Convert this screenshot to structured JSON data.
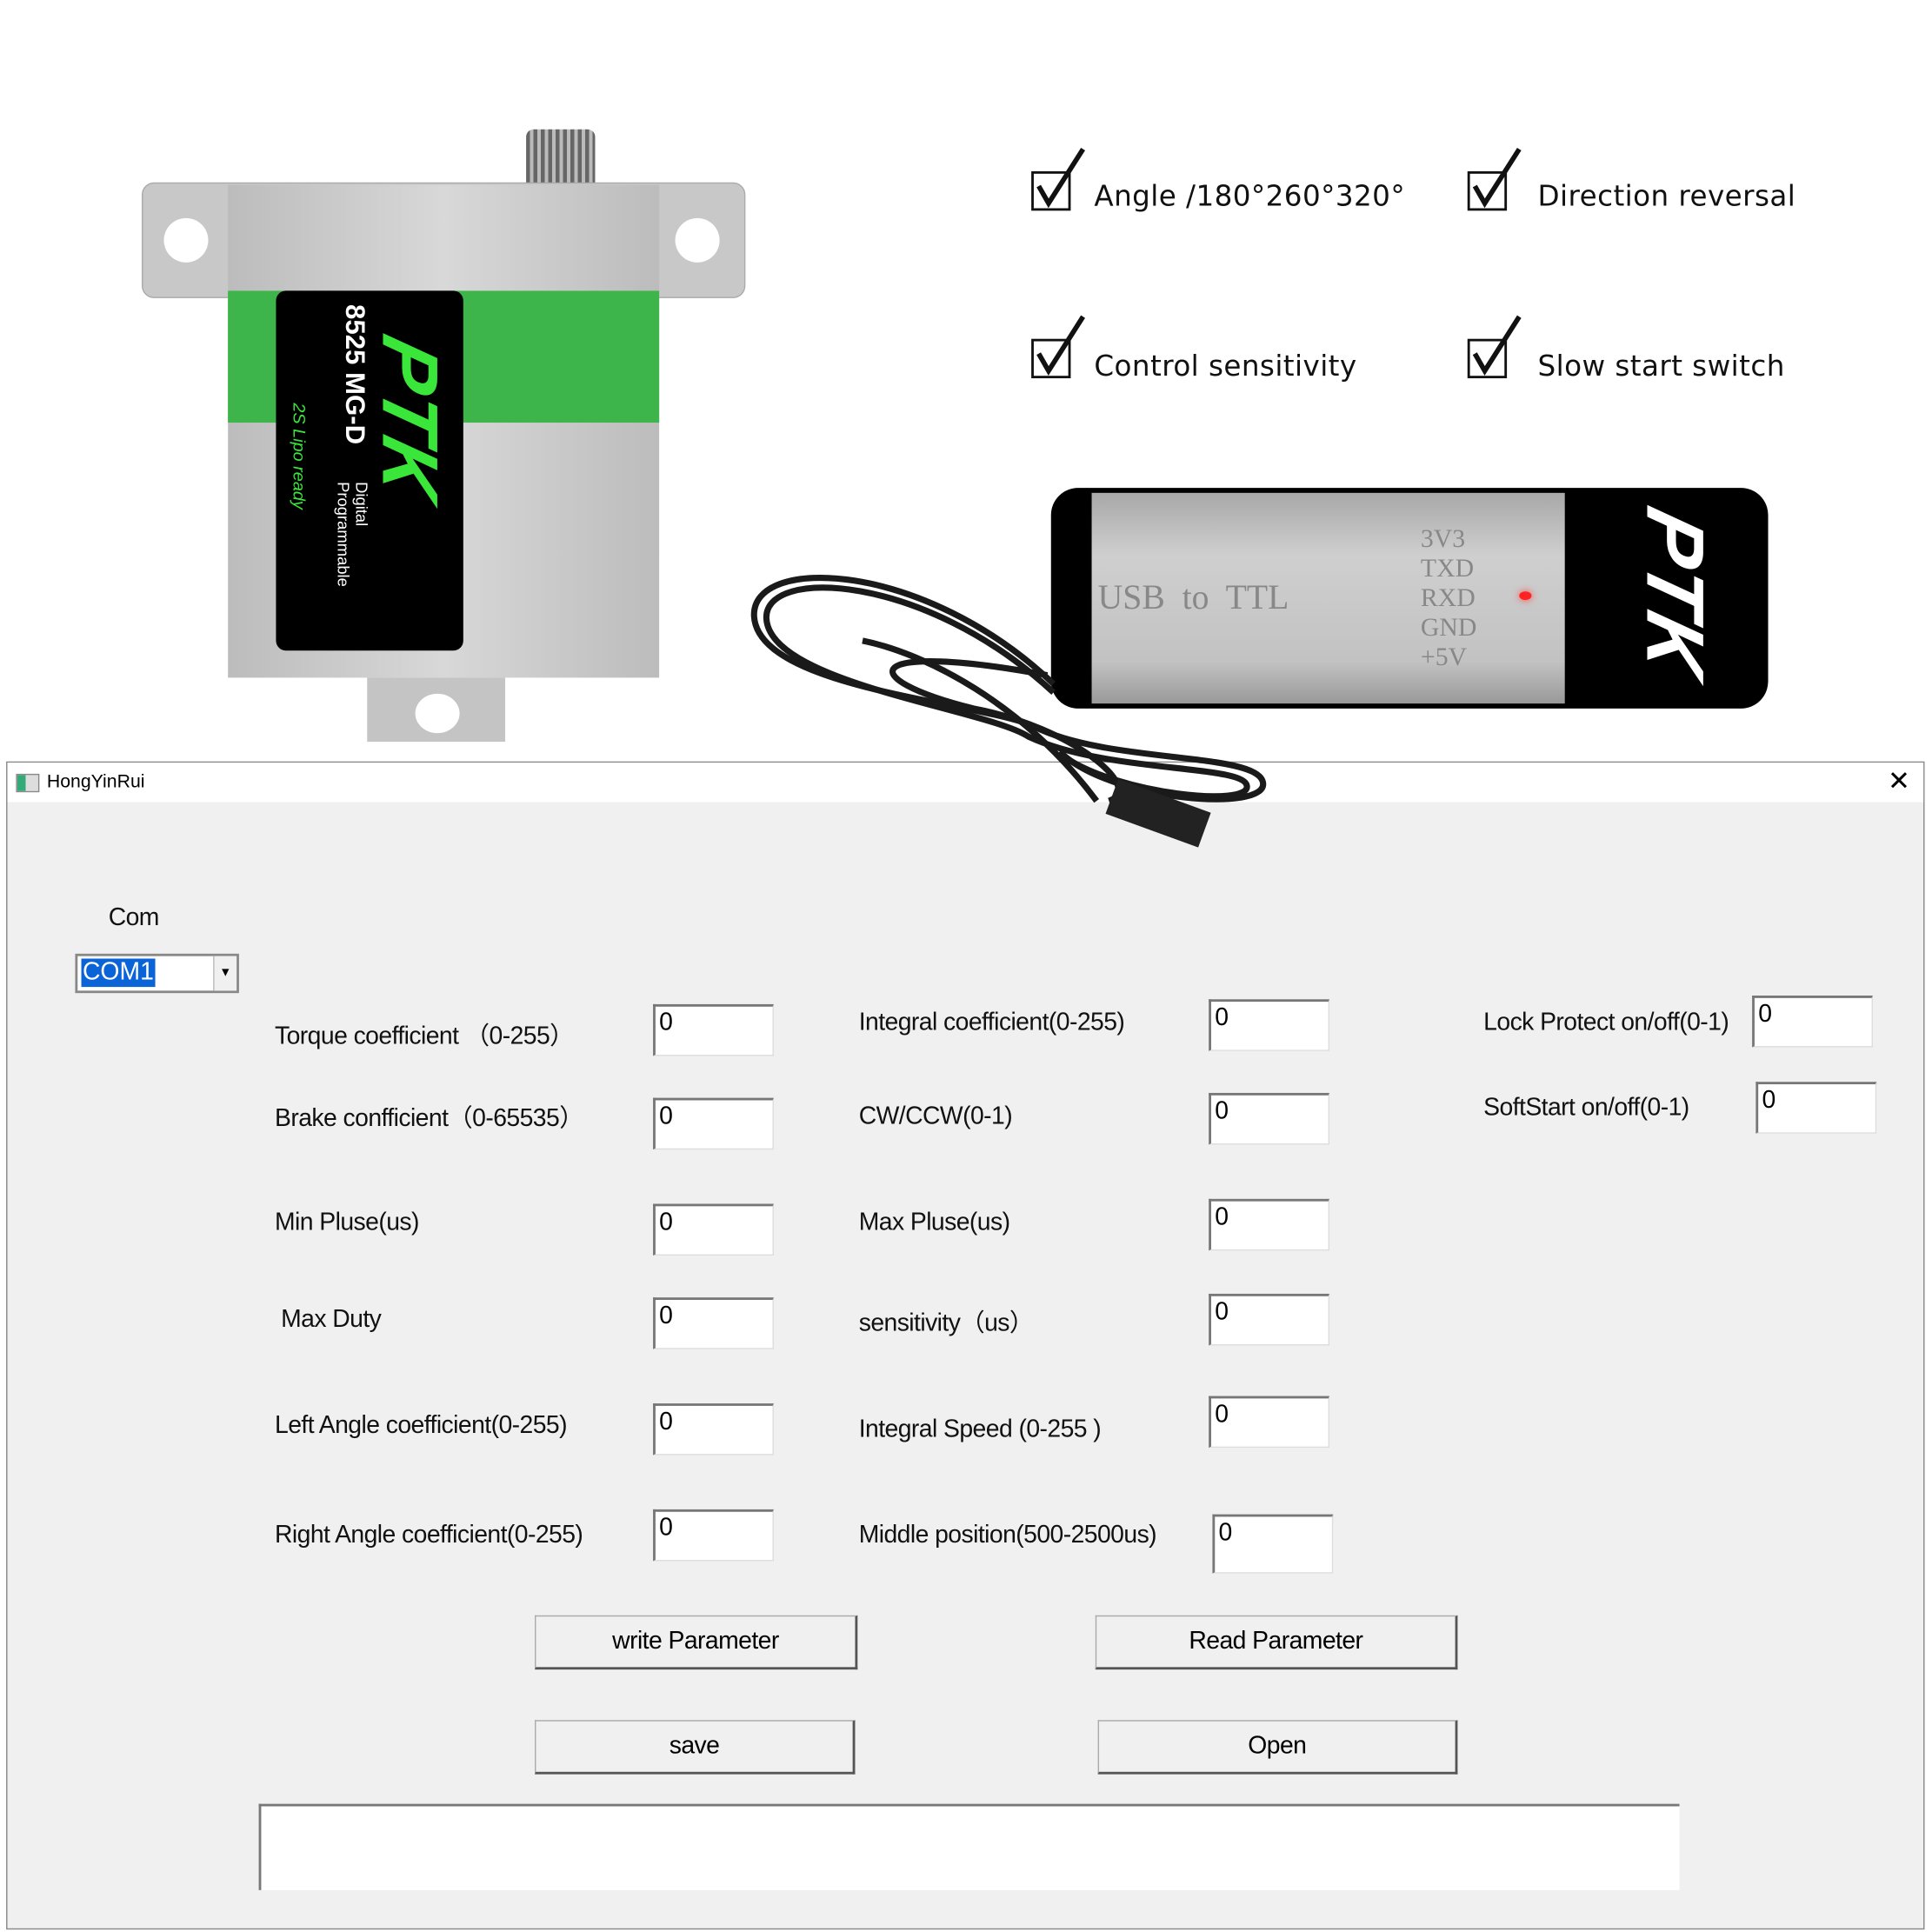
{
  "product": {
    "servo_model": "8525 MG-D",
    "servo_desc_1": "Digital",
    "servo_desc_2": "Programmable",
    "servo_tag": "2S Lipo ready",
    "brand": "PTK",
    "adapter_label": "USB  to  TTL",
    "adapter_pins": [
      "3V3",
      "TXD",
      "RXD",
      "GND",
      "+5V"
    ],
    "colors": {
      "band": "#3db54a",
      "logo": "#39e639",
      "label_bg": "#000000"
    }
  },
  "features": [
    {
      "label": "Angle /180°260°320°",
      "checked": true
    },
    {
      "label": "Direction reversal",
      "checked": true
    },
    {
      "label": "Control sensitivity",
      "checked": true
    },
    {
      "label": "Slow start switch",
      "checked": true
    }
  ],
  "window": {
    "title": "HongYinRui",
    "com_label": "Com",
    "com_value": "COM1",
    "fields": {
      "torque": {
        "label": "Torque coefficient （0-255）",
        "value": "0"
      },
      "brake": {
        "label": "Brake confficient（0-65535）",
        "value": "0"
      },
      "min_pulse": {
        "label": "Min Pluse(us)",
        "value": "0"
      },
      "max_duty": {
        "label": "Max Duty",
        "value": "0"
      },
      "left_angle": {
        "label": "Left Angle coefficient(0-255)",
        "value": "0"
      },
      "right_angle": {
        "label": "Right Angle coefficient(0-255)",
        "value": "0"
      },
      "integral": {
        "label": "Integral coefficient(0-255)",
        "value": "0"
      },
      "cwccw": {
        "label": "CW/CCW(0-1)",
        "value": "0"
      },
      "max_pulse": {
        "label": "Max Pluse(us)",
        "value": "0"
      },
      "sensitivity": {
        "label": "sensitivity（us）",
        "value": "0"
      },
      "integral_speed": {
        "label": "Integral Speed (0-255 )",
        "value": "0"
      },
      "middle": {
        "label": "Middle position(500-2500us)",
        "value": "0"
      },
      "lock_protect": {
        "label": "Lock Protect on/off(0-1)",
        "value": "0"
      },
      "softstart": {
        "label": "SoftStart on/off(0-1)",
        "value": "0"
      }
    },
    "buttons": {
      "write": "write Parameter",
      "read": "Read Parameter",
      "save": "save",
      "open": "Open"
    },
    "output_text": ""
  }
}
